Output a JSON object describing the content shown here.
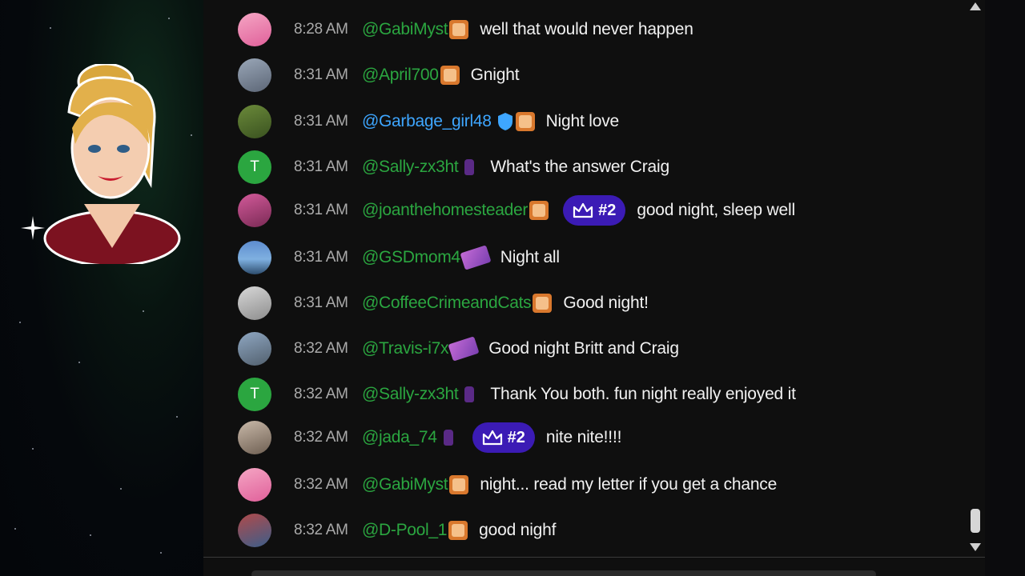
{
  "chat": {
    "messages": [
      {
        "time": "8:28 AM",
        "user": "@GabiMyst",
        "text": "well that would never happen"
      },
      {
        "time": "8:31 AM",
        "user": "@April700",
        "text": "Gnight"
      },
      {
        "time": "8:31 AM",
        "user": "@Garbage_girl48",
        "text": "Night love"
      },
      {
        "time": "8:31 AM",
        "user": "@Sally-zx3ht",
        "text": "What's the answer Craig",
        "avatar_letter": "T"
      },
      {
        "time": "8:31 AM",
        "user": "@joanthehomesteader",
        "text": "good night, sleep well",
        "pill": "#2"
      },
      {
        "time": "8:31 AM",
        "user": "@GSDmom4",
        "text": "Night all"
      },
      {
        "time": "8:31 AM",
        "user": "@CoffeeCrimeandCats",
        "text": "Good night!"
      },
      {
        "time": "8:32 AM",
        "user": "@Travis-i7x",
        "text": "Good night Britt and Craig"
      },
      {
        "time": "8:32 AM",
        "user": "@Sally-zx3ht",
        "text": "Thank You both. fun night really enjoyed it",
        "avatar_letter": "T"
      },
      {
        "time": "8:32 AM",
        "user": "@jada_74",
        "text": "nite nite!!!!",
        "pill": "#2"
      },
      {
        "time": "8:32 AM",
        "user": "@GabiMyst",
        "text": "night... read my letter if you get a chance"
      },
      {
        "time": "8:32 AM",
        "user": "@D-Pool_1",
        "text": "good nighf"
      }
    ]
  },
  "icons": {
    "crown": "crown-icon",
    "shield": "moderator-shield-icon",
    "scroll_up": "arrow-up-icon",
    "scroll_down": "arrow-down-icon"
  },
  "colors": {
    "username_green": "#2ba640",
    "username_blue": "#3ea6ff",
    "pill_purple": "#3b1bb5",
    "chat_bg": "#0f0f0f"
  }
}
